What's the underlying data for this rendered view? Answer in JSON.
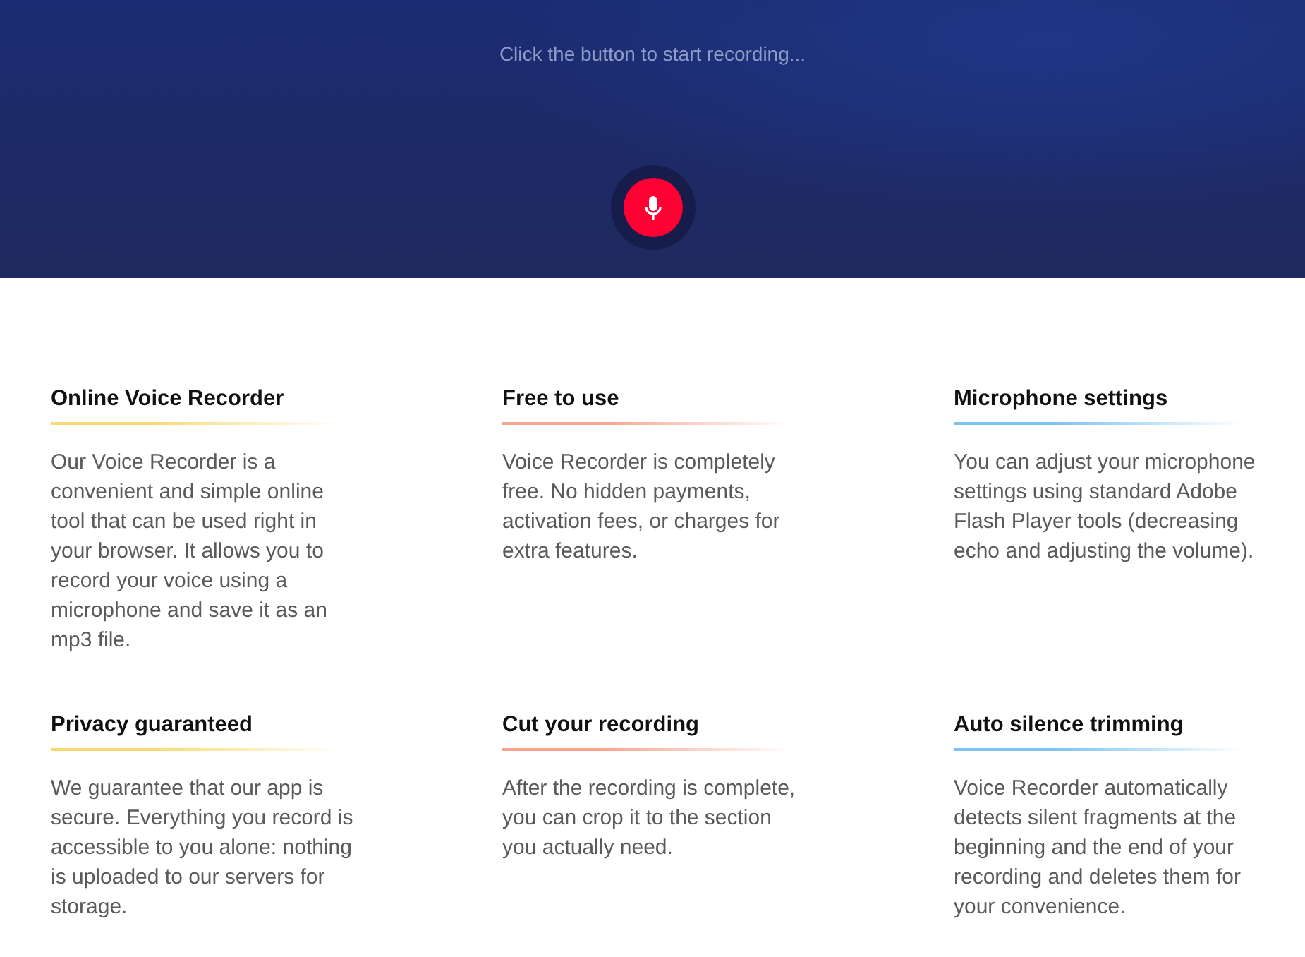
{
  "hero": {
    "prompt": "Click the button to start recording..."
  },
  "features": [
    {
      "title": "Online Voice Recorder",
      "text": "Our Voice Recorder is a convenient and simple online tool that can be used right in your browser. It allows you to record your voice using a microphone and save it as an mp3 file.",
      "color": "#f9d976"
    },
    {
      "title": "Free to use",
      "text": "Voice Recorder is completely free. No hidden payments, activation fees, or charges for extra features.",
      "color": "#f8a58e"
    },
    {
      "title": "Microphone settings",
      "text": "You can adjust your microphone settings using standard Adobe Flash Player tools (decreasing echo and adjusting the volume).",
      "color": "#7cc3f4"
    },
    {
      "title": "Privacy guaranteed",
      "text": "We guarantee that our app is secure. Everything you record is accessible to you alone: nothing is uploaded to our servers for storage.",
      "color": "#f9d976"
    },
    {
      "title": "Cut your recording",
      "text": "After the recording is complete, you can crop it to the section you actually need.",
      "color": "#f8a58e"
    },
    {
      "title": "Auto silence trimming",
      "text": "Voice Recorder automatically detects silent fragments at the beginning and the end of your recording and deletes them for your convenience.",
      "color": "#7cc3f4"
    }
  ]
}
